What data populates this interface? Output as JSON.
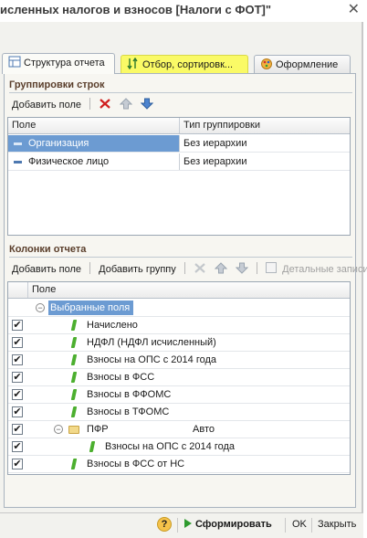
{
  "window": {
    "title": "исленных налогов и взносов [Налоги с ФОТ]\"",
    "close_glyph": "✕"
  },
  "tabs": [
    {
      "label": "Структура отчета",
      "active": true
    },
    {
      "label": "Отбор, сортировк...",
      "highlighted": true
    },
    {
      "label": "Оформление"
    }
  ],
  "row_groups": {
    "title": "Группировки строк",
    "toolbar": {
      "add_field": "Добавить поле"
    },
    "columns": [
      "Поле",
      "Тип группировки"
    ],
    "rows": [
      {
        "field": "Организация",
        "type": "Без иерархии",
        "selected": true
      },
      {
        "field": "Физическое лицо",
        "type": "Без иерархии"
      }
    ]
  },
  "report_columns": {
    "title": "Колонки отчета",
    "toolbar": {
      "add_field": "Добавить поле",
      "add_group": "Добавить группу",
      "detail_records": "Детальные записи"
    },
    "header": "Поле",
    "root_label": "Выбранные поля",
    "rows": [
      {
        "label": "Начислено",
        "checked": true,
        "icon": "leaf-icon"
      },
      {
        "label": "НДФЛ (НДФЛ исчисленный)",
        "checked": true,
        "icon": "leaf-icon"
      },
      {
        "label": "Взносы на ОПС с 2014 года",
        "checked": true,
        "icon": "leaf-icon"
      },
      {
        "label": "Взносы в ФСС",
        "checked": true,
        "icon": "leaf-icon"
      },
      {
        "label": "Взносы в ФФОМС",
        "checked": true,
        "icon": "leaf-icon"
      },
      {
        "label": "Взносы в ТФОМС",
        "checked": true,
        "icon": "leaf-icon"
      },
      {
        "label": "ПФР",
        "checked": true,
        "icon": "folder-icon",
        "extra": "Авто"
      },
      {
        "label": "Взносы на ОПС с 2014 года",
        "checked": true,
        "icon": "leaf-icon"
      },
      {
        "label": "Взносы в ФСС от НС",
        "checked": true,
        "icon": "leaf-icon"
      }
    ]
  },
  "statusbar": {
    "help": "?",
    "generate": "Сформировать",
    "ok": "OK",
    "close": "Закрыть"
  },
  "colors": {
    "selection": "#6c9bd2",
    "tab_highlight": "#fafa66",
    "section_title": "#5a3e2b",
    "leaf": "#4caf2f"
  }
}
